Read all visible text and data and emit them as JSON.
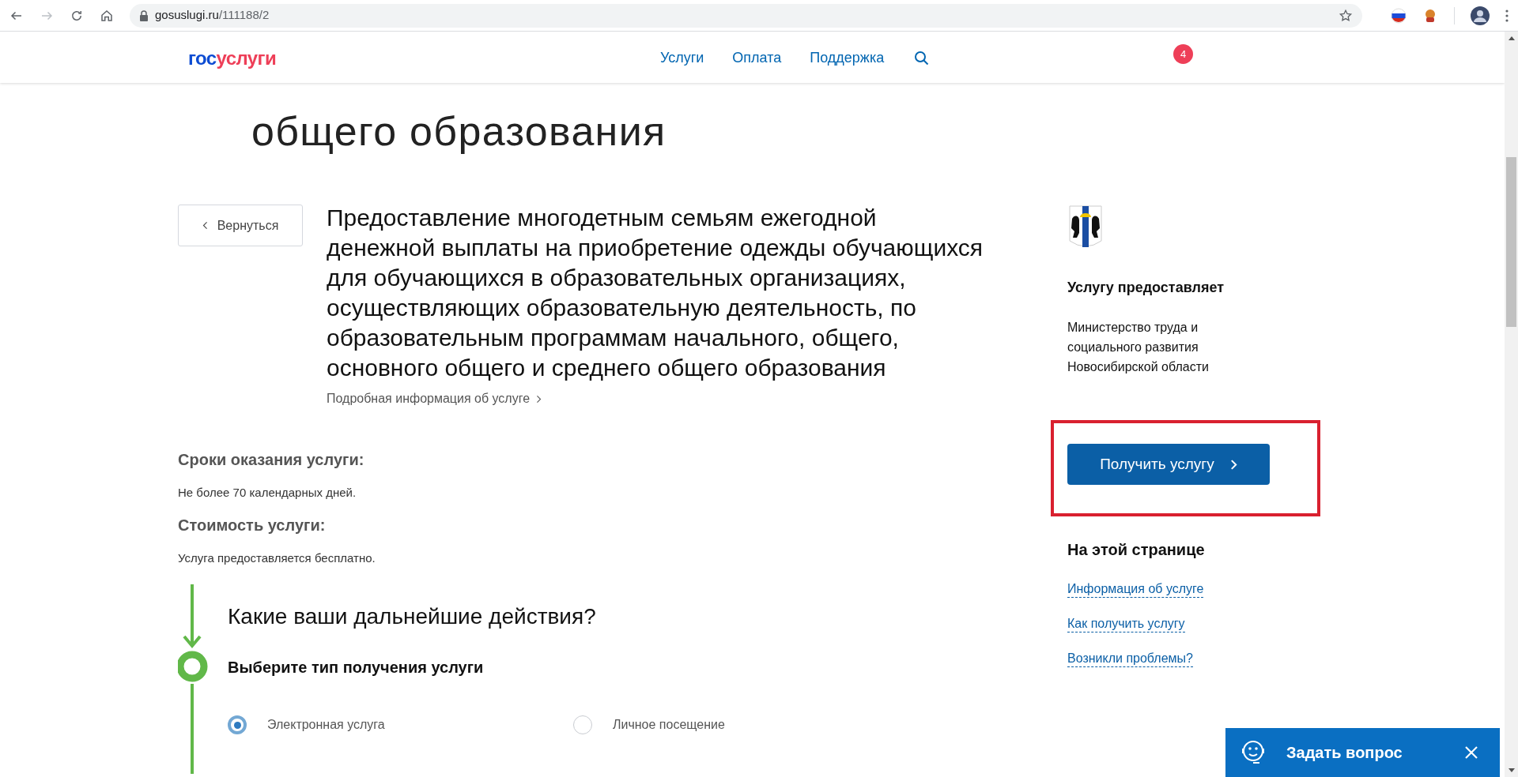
{
  "browser": {
    "url_host": "gosuslugi.ru",
    "url_path": "/111188/2"
  },
  "header": {
    "logo": {
      "first": "гос",
      "second": "услуги"
    },
    "nav": [
      "Услуги",
      "Оплата",
      "Поддержка"
    ],
    "badge": "4"
  },
  "page_title_lines": [
    "общего образования"
  ],
  "back_button": "Вернуться",
  "service_title_lines": [
    "Предоставление многодетным семьям ежегодной",
    "денежной выплаты на приобретение одежды обучающихся",
    "для обучающихся в образовательных организациях,",
    "осуществляющих образовательную деятельность, по",
    "образовательным программам начального, общего,",
    "основного общего и среднего общего образования"
  ],
  "details_link": "Подробная информация об услуге",
  "sections": [
    {
      "heading": "Сроки оказания услуги:",
      "text": "Не более 70 календарных дней."
    },
    {
      "heading": "Стоимость услуги:",
      "text": "Услуга предоставляется бесплатно."
    }
  ],
  "steps": {
    "heading": "Какие ваши дальнейшие действия?",
    "step_title": "Выберите тип получения услуги",
    "options": [
      {
        "label": "Электронная услуга",
        "selected": true
      },
      {
        "label": "Личное посещение",
        "selected": false
      }
    ]
  },
  "sidebar": {
    "provider_heading": "Услугу предоставляет",
    "provider_name": "Министерство труда и социального развития Новосибирской области",
    "get_button": {
      "label": "Получить услугу",
      "highlighted": true
    },
    "on_page_heading": "На этой странице",
    "on_page_links": [
      "Информация об услуге",
      "Как получить услугу",
      "Возникли проблемы?"
    ]
  },
  "chat": {
    "label": "Задать вопрос"
  }
}
